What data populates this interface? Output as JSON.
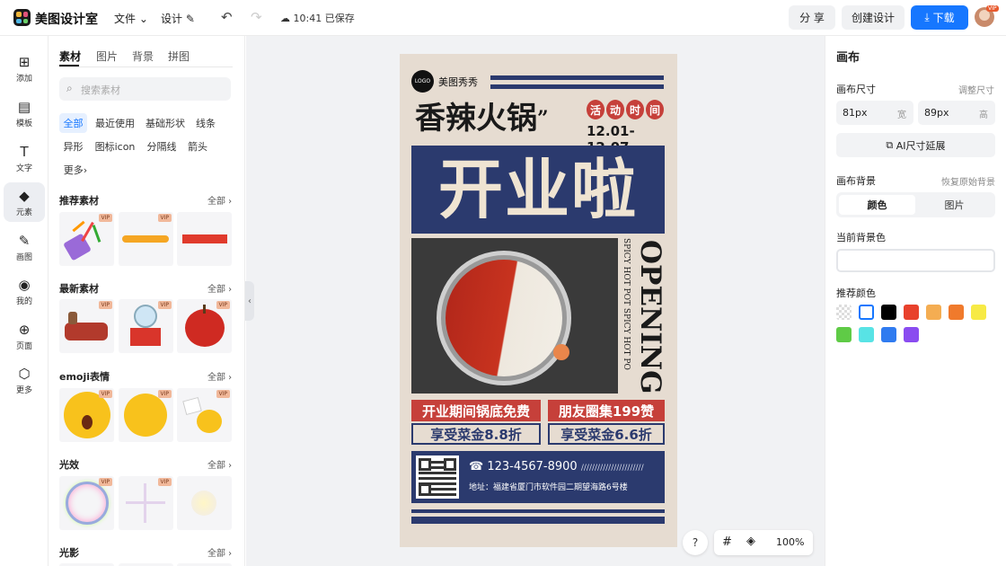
{
  "app": {
    "brand": "美图设计室"
  },
  "topbar": {
    "file_label": "文件",
    "design_label": "设计",
    "save_status": "10:41 已保存",
    "share_label": "分 享",
    "create_label": "创建设计",
    "download_label": "下载",
    "vip_badge": "VIP"
  },
  "leftnav": {
    "items": [
      {
        "label": "添加",
        "icon": "plus-square-icon"
      },
      {
        "label": "模板",
        "icon": "template-icon"
      },
      {
        "label": "文字",
        "icon": "text-icon"
      },
      {
        "label": "元素",
        "icon": "shapes-icon"
      },
      {
        "label": "画图",
        "icon": "pen-icon"
      },
      {
        "label": "我的",
        "icon": "user-icon"
      },
      {
        "label": "页面",
        "icon": "page-add-icon"
      },
      {
        "label": "更多",
        "icon": "cube-icon"
      }
    ]
  },
  "panel": {
    "tabs": [
      "素材",
      "图片",
      "背景",
      "拼图"
    ],
    "search_placeholder": "搜索素材",
    "chips": [
      "全部",
      "最近使用",
      "基础形状",
      "线条",
      "异形",
      "图标icon",
      "分隔线",
      "箭头",
      "更多"
    ],
    "all_label": "全部",
    "vip_label": "VIP",
    "sections": [
      "推荐素材",
      "最新素材",
      "emoji表情",
      "光效",
      "光影"
    ]
  },
  "poster": {
    "logo": "LOGO",
    "brand": "美图秀秀",
    "title": "香辣火锅",
    "activity": [
      "活",
      "动",
      "时",
      "间"
    ],
    "date": "12.01-12.07",
    "headline": "开业啦",
    "vertical_en": "OPENING",
    "vertical_small": "SPICY HOT POT  SPICY HOT PO",
    "offer1": "开业期间锅底免费",
    "offer1b": "享受菜金8.8折",
    "offer2": "朋友圈集199赞",
    "offer2b": "享受菜金6.6折",
    "phone": "123-4567-8900",
    "phone_slashes": "///////////////////////",
    "address": "地址：福建省厦门市软件园二期望海路6号楼"
  },
  "zoom": {
    "level": "100%",
    "help": "?"
  },
  "rightpanel": {
    "title": "画布",
    "size_label": "画布尺寸",
    "adjust_label": "调整尺寸",
    "width_value": "81px",
    "width_unit": "宽",
    "height_value": "89px",
    "height_unit": "高",
    "ai_extend": "AI尺寸延展",
    "bg_label": "画布背景",
    "restore_label": "恢复原始背景",
    "bg_tabs": [
      "颜色",
      "图片"
    ],
    "current_bg_label": "当前背景色",
    "recommend_label": "推荐颜色",
    "swatches": [
      "transparent",
      "#ffffff",
      "#000000",
      "#e8412c",
      "#f4ad52",
      "#f07a2c",
      "#f7ea45",
      "#5fcb46",
      "#58e3e5",
      "#2f7bf0",
      "#8a4cf0"
    ]
  }
}
